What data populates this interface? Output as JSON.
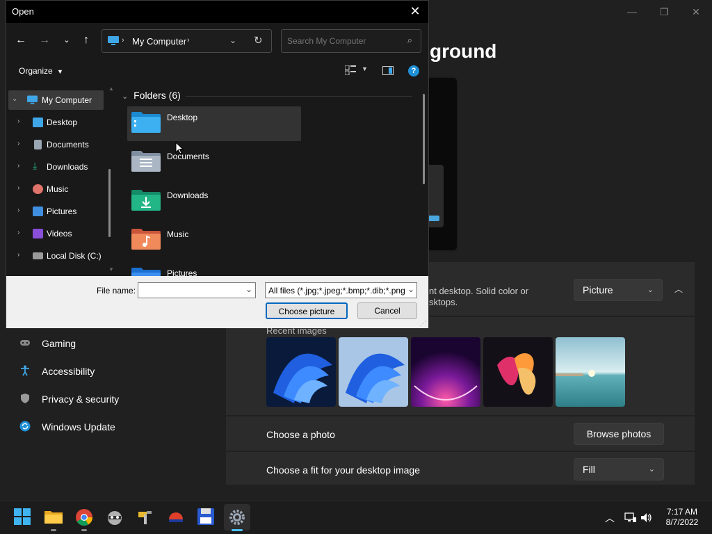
{
  "settings": {
    "title": "ground",
    "personalize_desc": "nt desktop. Solid color or sktops.",
    "personalize_value": "Picture",
    "recent_label": "Recent images",
    "choose_photo_label": "Choose a photo",
    "browse_button": "Browse photos",
    "fit_label": "Choose a fit for your desktop image",
    "fit_value": "Fill",
    "nav": [
      {
        "label": "Gaming",
        "icon": "gamepad-icon"
      },
      {
        "label": "Accessibility",
        "icon": "accessibility-icon"
      },
      {
        "label": "Privacy & security",
        "icon": "shield-icon"
      },
      {
        "label": "Windows Update",
        "icon": "update-icon"
      }
    ]
  },
  "dialog": {
    "title": "Open",
    "address": "My Computer",
    "search_placeholder": "Search My Computer",
    "organize_label": "Organize",
    "tree": [
      {
        "label": "My Computer",
        "icon": "computer-icon"
      },
      {
        "label": "Desktop",
        "icon": "desktop-icon"
      },
      {
        "label": "Documents",
        "icon": "documents-icon"
      },
      {
        "label": "Downloads",
        "icon": "downloads-icon"
      },
      {
        "label": "Music",
        "icon": "music-icon"
      },
      {
        "label": "Pictures",
        "icon": "pictures-icon"
      },
      {
        "label": "Videos",
        "icon": "videos-icon"
      },
      {
        "label": "Local Disk (C:)",
        "icon": "disk-icon"
      }
    ],
    "group_header": "Folders (6)",
    "folders": [
      {
        "label": "Desktop"
      },
      {
        "label": "Documents"
      },
      {
        "label": "Downloads"
      },
      {
        "label": "Music"
      },
      {
        "label": "Pictures"
      }
    ],
    "filename_label": "File name:",
    "filename_value": "",
    "filetype_value": "All files (*.jpg;*.jpeg;*.bmp;*.dib;*.png",
    "choose_button": "Choose picture",
    "cancel_button": "Cancel"
  },
  "taskbar": {
    "time": "7:17 AM",
    "date": "8/7/2022"
  },
  "colors": {
    "accent": "#4cc2ff",
    "dialog_bg": "#191919",
    "settings_bg": "#202020"
  }
}
